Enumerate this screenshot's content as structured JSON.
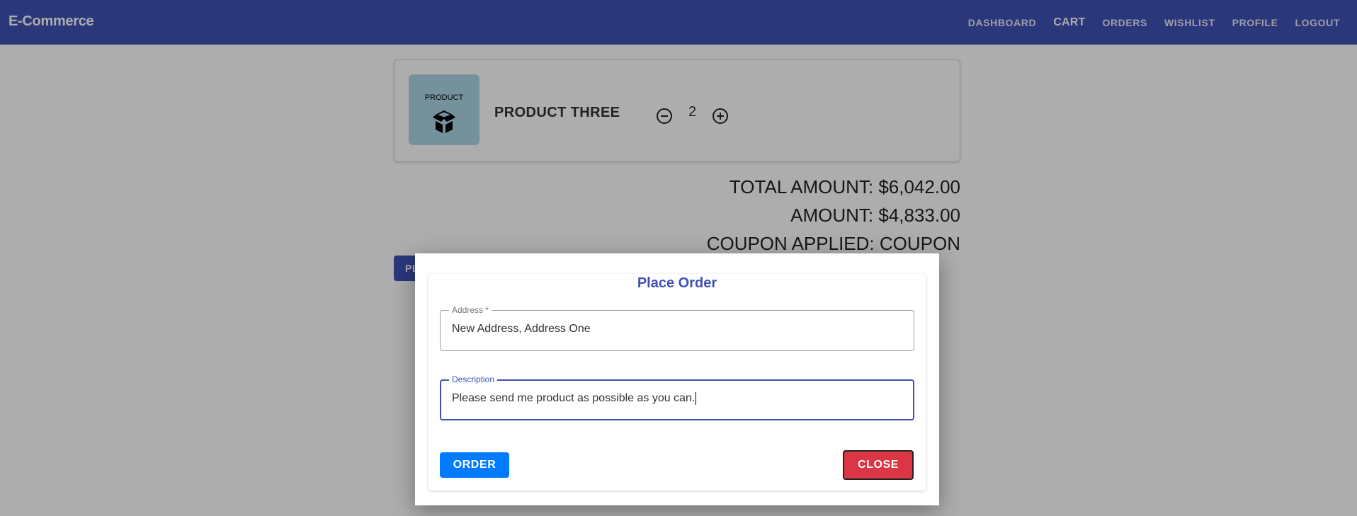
{
  "navbar": {
    "brand": "E-Commerce",
    "links": [
      {
        "label": "DASHBOARD"
      },
      {
        "label": "CART"
      },
      {
        "label": "ORDERS"
      },
      {
        "label": "WISHLIST"
      },
      {
        "label": "PROFILE"
      },
      {
        "label": "LOGOUT"
      }
    ],
    "active": "CART",
    "color": "#3f51b5"
  },
  "cart": {
    "items": [
      {
        "thumb_label": "PRODUCT",
        "thumb_icon": "box-icon",
        "thumb_color": "#add8e6",
        "name": "PRODUCT THREE",
        "quantity": "2",
        "decrement_icon": "minus-circle-icon",
        "increment_icon": "plus-circle-icon"
      }
    ],
    "total_amount": "TOTAL AMOUNT: $6,042.00",
    "amount": "AMOUNT: $4,833.00",
    "coupon": "COUPON APPLIED: COUPON",
    "place_order_label": "PLACE ORDER"
  },
  "modal": {
    "title": "Place Order",
    "address": {
      "label": "Address *",
      "value": "New Address, Address One"
    },
    "description": {
      "label": "Description",
      "value": "Please send me product as possible as you can."
    },
    "order_label": "ORDER",
    "close_label": "CLOSE",
    "order_color": "#007bff",
    "close_color": "#dc3545"
  }
}
